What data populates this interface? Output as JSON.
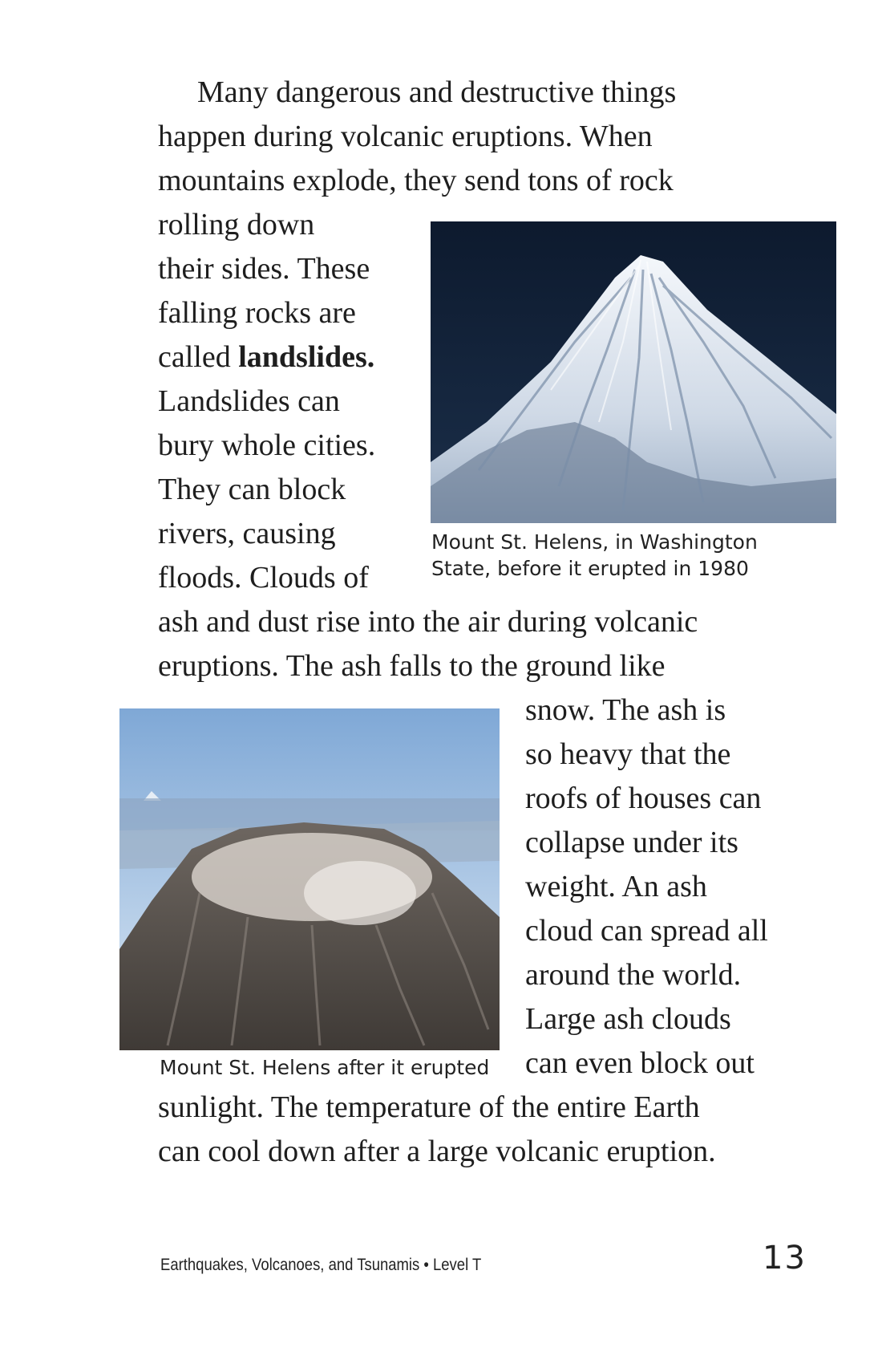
{
  "paragraph_lines": {
    "l1": "Many dangerous and destructive things",
    "l2": "happen during volcanic eruptions. When",
    "l3": "mountains explode, they send tons of rock",
    "l4": "rolling down",
    "l5": "their sides. These",
    "l6": "falling rocks are",
    "l7a": "called ",
    "l7b": "landslides.",
    "l8": "Landslides can",
    "l9": "bury whole cities.",
    "l10": "They can block",
    "l11": "rivers, causing",
    "l12": "floods. Clouds of",
    "l13": "ash and dust rise into the air during volcanic",
    "l14": "eruptions. The ash falls to the ground like",
    "l15": "snow. The ash is",
    "l16": "so heavy that the",
    "l17": "roofs of houses can",
    "l18": "collapse under its",
    "l19": "weight. An ash",
    "l20": "cloud can spread all",
    "l21": "around the world.",
    "l22": "Large ash clouds",
    "l23": "can even block out",
    "l24": "sunlight. The temperature of the entire Earth",
    "l25": "can cool down after a large volcanic eruption."
  },
  "photo_before": {
    "caption_line1": "Mount St. Helens, in Washington",
    "caption_line2": "State, before it erupted in 1980"
  },
  "photo_after": {
    "caption": "Mount St. Helens after it erupted"
  },
  "footer": {
    "book_title": "Earthquakes, Volcanoes, and Tsunamis • Level T",
    "page_number": "13"
  }
}
